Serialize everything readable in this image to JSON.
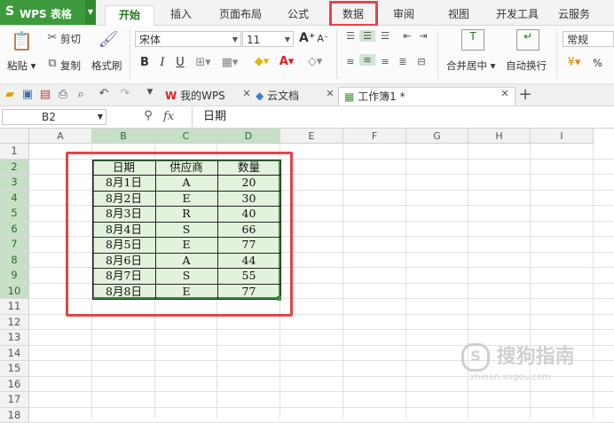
{
  "app": {
    "logo": "S",
    "name": "WPS 表格"
  },
  "ribbon_tabs": [
    "开始",
    "插入",
    "页面布局",
    "公式",
    "数据",
    "审阅",
    "视图",
    "开发工具",
    "云服务"
  ],
  "ribbon": {
    "paste": "粘贴",
    "cut": "剪切",
    "copy": "复制",
    "format_painter": "格式刷",
    "font_name": "宋体",
    "font_size": "11",
    "merge_center": "合并居中",
    "wrap_text": "自动换行",
    "number_format": "常规",
    "percent": "%"
  },
  "doc_tabs": [
    {
      "label": "我的WPS"
    },
    {
      "label": "云文档"
    },
    {
      "label": "工作簿1 *"
    }
  ],
  "formula_bar": {
    "name_box": "B2",
    "fx": "fx",
    "value": "日期"
  },
  "columns": [
    "A",
    "B",
    "C",
    "D",
    "E",
    "F",
    "G",
    "H",
    "I"
  ],
  "rows": [
    "1",
    "2",
    "3",
    "4",
    "5",
    "6",
    "7",
    "8",
    "9",
    "10",
    "11",
    "12",
    "13",
    "14",
    "15",
    "16",
    "17",
    "18"
  ],
  "table": {
    "headers": [
      "日期",
      "供应商",
      "数量"
    ],
    "rows": [
      [
        "8月1日",
        "A",
        "20"
      ],
      [
        "8月2日",
        "E",
        "30"
      ],
      [
        "8月3日",
        "R",
        "40"
      ],
      [
        "8月4日",
        "S",
        "66"
      ],
      [
        "8月5日",
        "E",
        "77"
      ],
      [
        "8月6日",
        "A",
        "44"
      ],
      [
        "8月7日",
        "S",
        "55"
      ],
      [
        "8月8日",
        "E",
        "77"
      ]
    ]
  },
  "watermark": {
    "text": "搜狗指南",
    "sub": "zhinan.sogou.com"
  },
  "colors": {
    "brand": "#3d9b3d",
    "highlight": "#e0464a",
    "selection": "#e2f2dc"
  }
}
